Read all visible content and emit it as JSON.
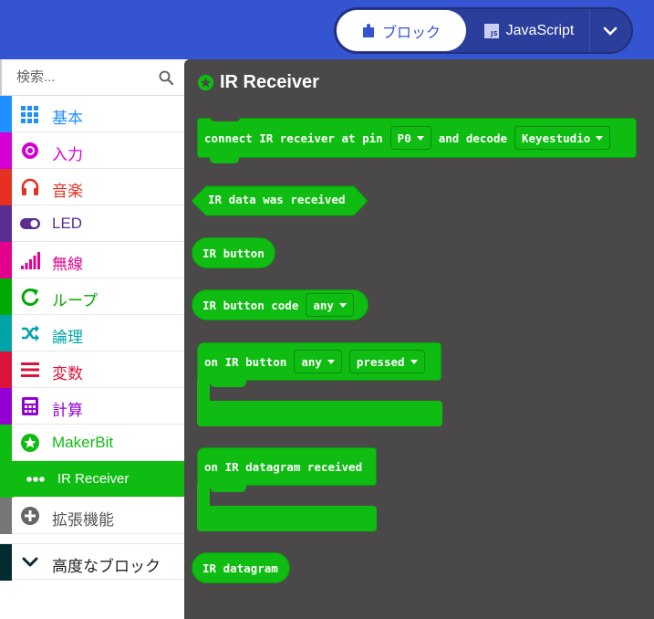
{
  "header": {
    "blocks_label": "ブロック",
    "javascript_label": "JavaScript"
  },
  "sidebar": {
    "search_placeholder": "検索...",
    "categories": [
      {
        "label": "基本",
        "color": "#1e90ff",
        "icon": "grid-icon"
      },
      {
        "label": "入力",
        "color": "#d400d4",
        "icon": "target-icon"
      },
      {
        "label": "音楽",
        "color": "#e63022",
        "icon": "headphones-icon"
      },
      {
        "label": "LED",
        "color": "#5c2d91",
        "icon": "toggle-icon"
      },
      {
        "label": "無線",
        "color": "#e3008c",
        "icon": "signal-bars-icon"
      },
      {
        "label": "ループ",
        "color": "#00aa00",
        "icon": "loop-icon"
      },
      {
        "label": "論理",
        "color": "#00a4a6",
        "icon": "shuffle-icon"
      },
      {
        "label": "変数",
        "color": "#dc143c",
        "icon": "list-icon"
      },
      {
        "label": "計算",
        "color": "#9400d3",
        "icon": "calculator-icon"
      },
      {
        "label": "MakerBit",
        "color": "#0fbc11",
        "icon": "star-circle-icon"
      },
      {
        "label": "IR Receiver",
        "color": "#0fbc11",
        "icon": "dots-icon",
        "selected": true
      },
      {
        "label": "拡張機能",
        "color": "#777777",
        "icon": "plus-circle-icon"
      },
      {
        "label": "高度なブロック",
        "color": "#042b30",
        "icon": "chevron-down-icon"
      }
    ]
  },
  "workspace": {
    "title": "IR Receiver",
    "blocks": {
      "connect": {
        "prefix": "connect IR receiver at pin",
        "pin": "P0",
        "middle": "and decode",
        "protocol": "Keyestudio"
      },
      "data_received": "IR data was received",
      "ir_button": "IR button",
      "ir_button_code": {
        "label": "IR button code",
        "value": "any"
      },
      "on_ir_button": {
        "label": "on IR button",
        "button": "any",
        "action": "pressed"
      },
      "on_datagram": "on IR datagram received",
      "ir_datagram": "IR datagram"
    }
  },
  "colors": {
    "header": "#3454d1",
    "workspace": "#4a4849",
    "block": "#0fbc11"
  }
}
